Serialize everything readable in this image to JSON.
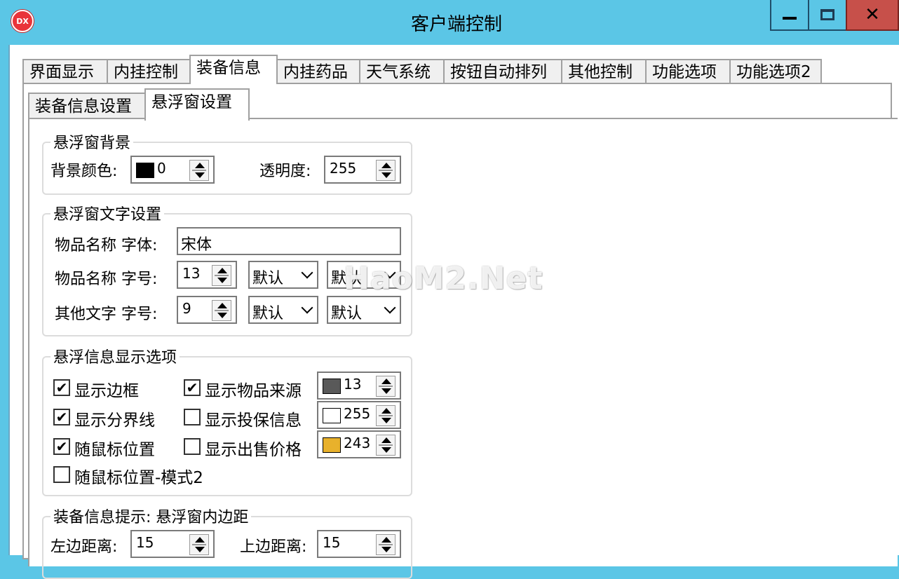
{
  "window": {
    "title": "客户端控制",
    "icon_text": "DX",
    "close_glyph": "✕"
  },
  "tabs": [
    "界面显示",
    "内挂控制",
    "装备信息",
    "内挂药品",
    "天气系统",
    "按钮自动排列",
    "其他控制",
    "功能选项",
    "功能选项2"
  ],
  "active_tab": "装备信息",
  "subtabs": [
    "装备信息设置",
    "悬浮窗设置"
  ],
  "active_subtab": "悬浮窗设置",
  "group_background": {
    "title": "悬浮窗背景",
    "bg_color_label": "背景颜色:",
    "bg_color_value": "0",
    "bg_color_swatch": "#000000",
    "opacity_label": "透明度:",
    "opacity_value": "255"
  },
  "group_text": {
    "title": "悬浮窗文字设置",
    "item_font_label": "物品名称 字体:",
    "item_font_value": "宋体",
    "item_size_label": "物品名称 字号:",
    "item_size_value": "13",
    "item_combo1": "默认",
    "item_combo2": "默认",
    "other_size_label": "其他文字 字号:",
    "other_size_value": "9",
    "other_combo1": "默认",
    "other_combo2": "默认"
  },
  "group_display": {
    "title": "悬浮信息显示选项",
    "options": [
      {
        "label": "显示边框",
        "checked": true
      },
      {
        "label": "显示分界线",
        "checked": true
      },
      {
        "label": "随鼠标位置",
        "checked": true
      },
      {
        "label": "随鼠标位置-模式2",
        "checked": false
      },
      {
        "label": "显示物品来源",
        "checked": true
      },
      {
        "label": "显示投保信息",
        "checked": false
      },
      {
        "label": "显示出售价格",
        "checked": false
      }
    ],
    "colors": [
      {
        "value": "13",
        "swatch": "#595959"
      },
      {
        "value": "255",
        "swatch": "#ffffff"
      },
      {
        "value": "243",
        "swatch": "#e8b12c"
      }
    ]
  },
  "group_padding": {
    "title": "装备信息提示: 悬浮窗内边距",
    "left_label": "左边距离:",
    "left_value": "15",
    "top_label": "上边距离:",
    "top_value": "15"
  },
  "watermark": "HaoM2.Net"
}
